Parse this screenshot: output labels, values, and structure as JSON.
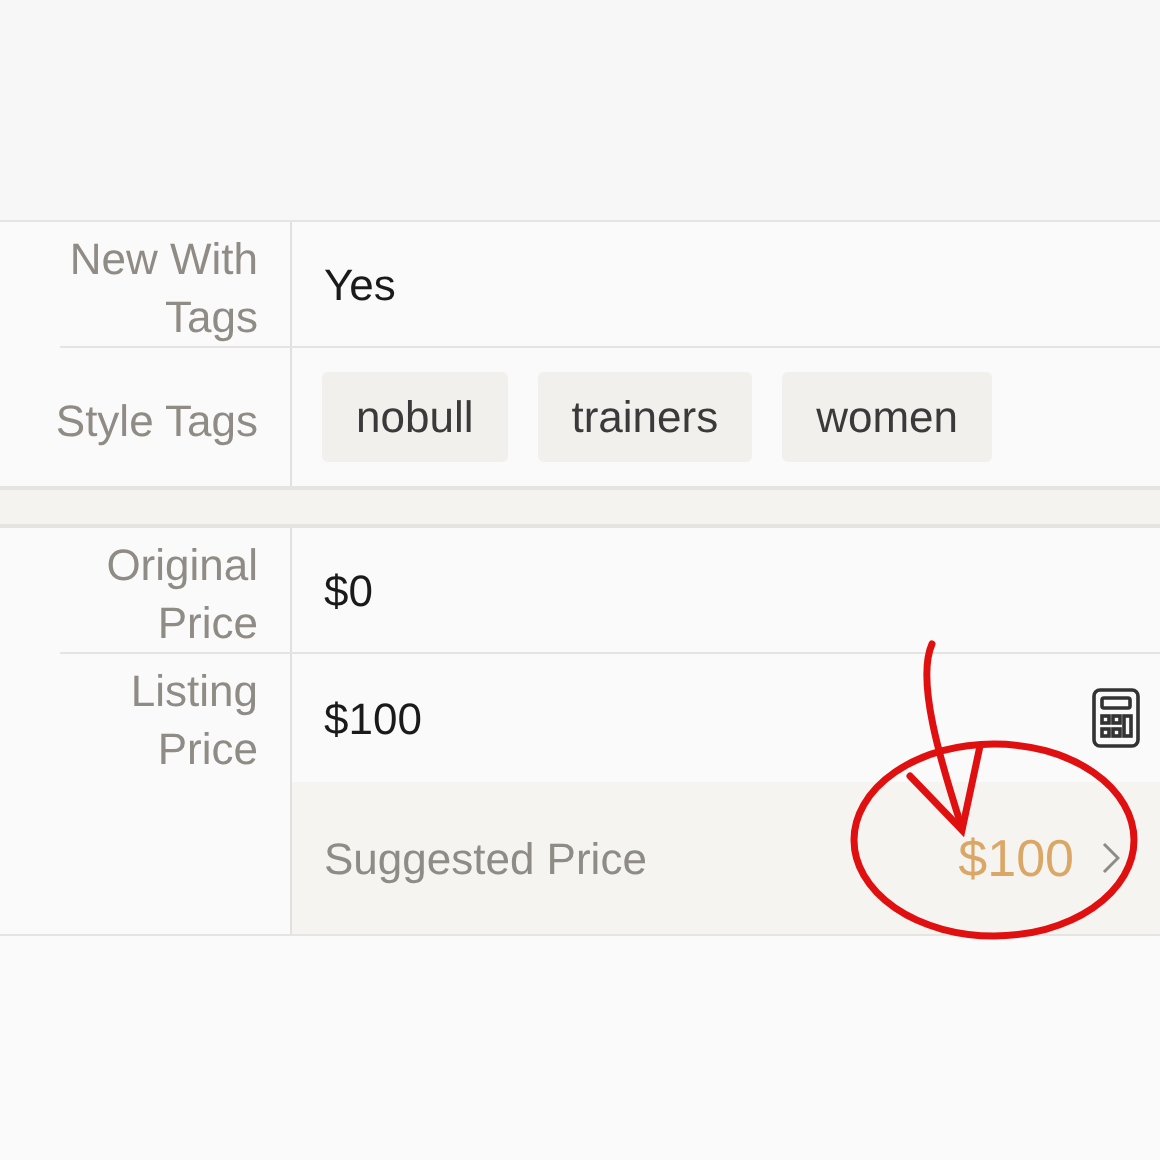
{
  "sections": [
    {
      "rows": [
        {
          "kind": "text",
          "label": "New With Tags",
          "value": "Yes"
        },
        {
          "kind": "tags",
          "label": "Style Tags",
          "tags": [
            "nobull",
            "trainers",
            "women"
          ]
        }
      ]
    },
    {
      "rows": [
        {
          "kind": "text",
          "label": "Original Price",
          "value": "$0"
        },
        {
          "kind": "price",
          "label": "Listing Price",
          "value": "$100",
          "suggestion": {
            "label": "Suggested Price",
            "value": "$100"
          }
        }
      ]
    }
  ]
}
